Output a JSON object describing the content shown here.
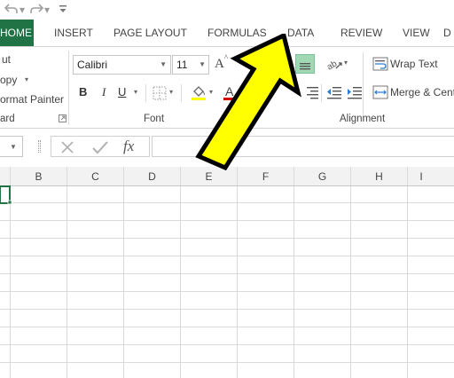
{
  "quick_access": {
    "undo_icon": "undo-icon",
    "redo_icon": "redo-icon",
    "customize_icon": "customize-qat-icon"
  },
  "tabs": [
    {
      "label": "HOME",
      "active": true
    },
    {
      "label": "INSERT"
    },
    {
      "label": "PAGE LAYOUT"
    },
    {
      "label": "FORMULAS"
    },
    {
      "label": "DATA"
    },
    {
      "label": "REVIEW"
    },
    {
      "label": "VIEW"
    },
    {
      "label": "D"
    }
  ],
  "clipboard": {
    "cut_label": "ut",
    "copy_label": "opy",
    "format_painter_label": "ormat Painter",
    "group_label": "ard"
  },
  "font": {
    "name": "Calibri",
    "size": "11",
    "increase_label": "A",
    "group_label": "Font",
    "bold_label": "B",
    "italic_label": "I",
    "underline_label": "U",
    "font_color_label": "A"
  },
  "alignment": {
    "wrap_text_label": "Wrap Text",
    "merge_label": "Merge & Cent",
    "group_label": "Alignment"
  },
  "formula_bar": {
    "fx_label": "fx",
    "value": ""
  },
  "grid": {
    "columns": [
      "B",
      "C",
      "D",
      "E",
      "F",
      "G",
      "H",
      "I"
    ]
  },
  "colors": {
    "accent": "#217346",
    "arrow_fill": "#ffff00",
    "arrow_stroke": "#000000",
    "font_color_bar": "#d40000",
    "fill_color_bar": "#ffff00",
    "active_align": "#a0d8b3"
  }
}
